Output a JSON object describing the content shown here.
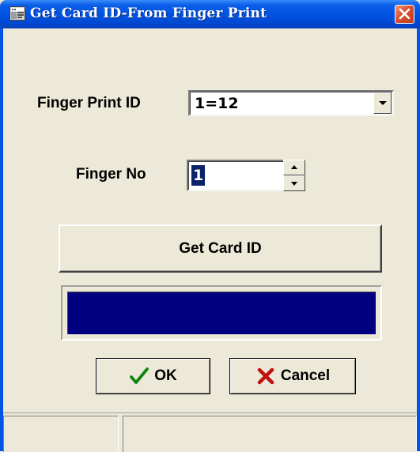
{
  "window": {
    "title": "Get Card ID-From Finger Print",
    "titlebar_color": "#0054e3",
    "background_color": "#ece9d8"
  },
  "icons": {
    "app": "app-icon",
    "close": "close-icon",
    "dropdown": "chevron-down-icon",
    "spin_up": "spin-up-icon",
    "spin_down": "spin-down-icon",
    "ok": "checkmark-icon",
    "cancel": "x-icon"
  },
  "form": {
    "finger_print_id_label": "Finger Print ID",
    "finger_print_id_value": "1=12",
    "finger_no_label": "Finger No",
    "finger_no_value": "1"
  },
  "buttons": {
    "get_card_id": "Get Card ID",
    "ok": "OK",
    "cancel": "Cancel"
  },
  "result": {
    "value": "",
    "color": "#000080"
  },
  "statusbar": {
    "panel1": "",
    "panel2": ""
  }
}
